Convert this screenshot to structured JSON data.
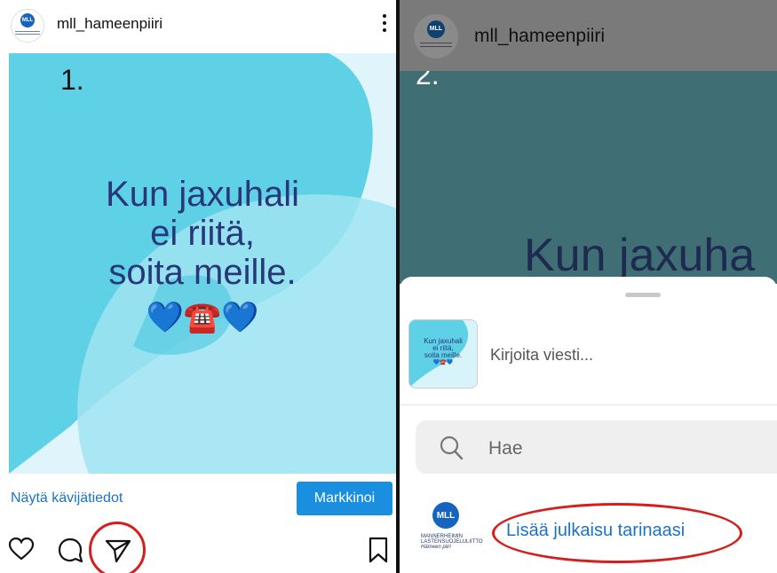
{
  "panel1": {
    "username": "mll_hameenpiiri",
    "step": "1.",
    "slogan": [
      "Kun jaxuhali",
      "ei riitä,",
      "soita meille."
    ],
    "emoji": "💙☎️💙",
    "insights_link": "Näytä kävijätiedot",
    "promote_button": "Markkinoi",
    "icons": [
      "heart-icon",
      "comment-icon",
      "share-icon",
      "bookmark-icon",
      "more-icon"
    ]
  },
  "panel2": {
    "username": "mll_hameenpiiri",
    "step": "2.",
    "slogan_partial": "Kun jaxuha",
    "message_placeholder": "Kirjoita viesti...",
    "search_placeholder": "Hae",
    "add_to_story": "Lisää julkaisu tarinaasi",
    "thumbnail_text": [
      "Kun jaxuhali",
      "ei riitä,",
      "soita meille."
    ],
    "thumbnail_emoji": "💙☎️💙",
    "logo": {
      "abbr": "MLL",
      "line1": "MANNERHEIMIN",
      "line2": "LASTENSUOJELULIITTO",
      "line3": "Hämeen piiri"
    }
  },
  "colors": {
    "accent_blue": "#1a73c8",
    "button_blue": "#1a8fe0",
    "slogan_navy": "#263879",
    "highlight_red": "#d51f1f",
    "post_light": "#dff5fb"
  }
}
